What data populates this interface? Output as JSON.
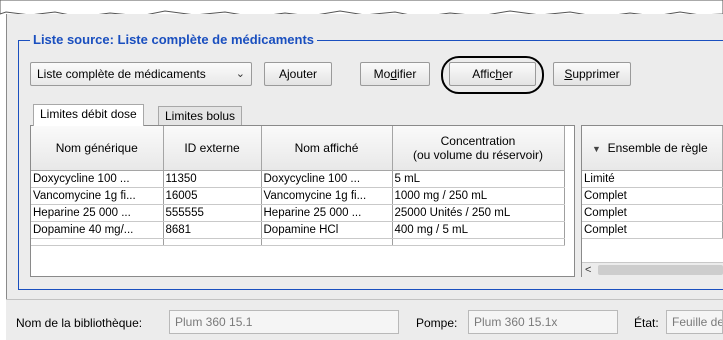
{
  "group": {
    "title": "Liste source: Liste complète de médicaments"
  },
  "dropdown": {
    "value": "Liste complète de médicaments"
  },
  "buttons": {
    "add": {
      "pre": "A",
      "ul": "j",
      "post": "outer"
    },
    "modify": {
      "pre": "Mo",
      "ul": "d",
      "post": "ifier"
    },
    "show": {
      "pre": "Affic",
      "ul": "h",
      "post": "er"
    },
    "delete": {
      "pre": "",
      "ul": "S",
      "post": "upprimer"
    }
  },
  "tabs": [
    "Limites débit dose",
    "Limites bolus"
  ],
  "table": {
    "headers": {
      "generic": "Nom générique",
      "external_id": "ID externe",
      "display": "Nom affiché",
      "conc_line1": "Concentration",
      "conc_line2": "(ou volume du réservoir)"
    },
    "rows": [
      [
        "Doxycycline 100 ...",
        "11350",
        "Doxycycline 100 ...",
        "5 mL"
      ],
      [
        "Vancomycine 1g fi...",
        "16005",
        "Vancomycine 1g fi...",
        "1000 mg / 250 mL"
      ],
      [
        "Heparine 25 000 ...",
        "555555",
        "Heparine 25 000 ...",
        "25000 Unités / 250 mL"
      ],
      [
        "Dopamine 40 mg/...",
        "8681",
        "Dopamine HCl",
        "400 mg / 5 mL"
      ]
    ]
  },
  "rules": {
    "header": "Ensemble de règle",
    "values": [
      "Limité",
      "Complet",
      "Complet",
      "Complet"
    ]
  },
  "status": {
    "library_label": "Nom de la bibliothèque:",
    "library_value": "Plum 360 15.1",
    "pump_label": "Pompe:",
    "pump_value": "Plum 360 15.1x",
    "state_label": "État:",
    "state_value": "Feuille de"
  }
}
